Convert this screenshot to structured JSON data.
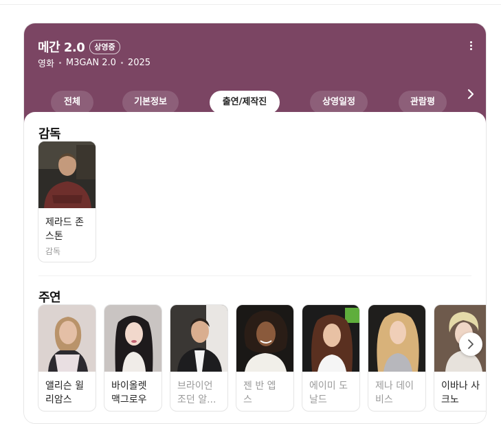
{
  "movie": {
    "title": "메간 2.0",
    "status_badge": "상영중",
    "meta": [
      "영화",
      "M3GAN 2.0",
      "2025"
    ]
  },
  "tabs": [
    "전체",
    "기본정보",
    "출연/제작진",
    "상영일정",
    "관람평"
  ],
  "active_tab": "출연/제작진",
  "directors": {
    "heading": "감독",
    "people": [
      {
        "name_lines": [
          "제라드 존",
          "스톤"
        ],
        "role": "감독"
      }
    ]
  },
  "cast": {
    "heading": "주연",
    "people": [
      {
        "name_lines": [
          "앨리슨 윌",
          "리암스"
        ]
      },
      {
        "name_lines": [
          "바이올렛",
          "맥그로우"
        ]
      },
      {
        "name_lines": [
          "브라이언",
          "조던 알..."
        ]
      },
      {
        "name_lines": [
          "젠 반 엡",
          "스"
        ]
      },
      {
        "name_lines": [
          "에이미 도",
          "날드"
        ]
      },
      {
        "name_lines": [
          "제나 데이",
          "비스"
        ]
      },
      {
        "name_lines": [
          "이바나 사",
          "크노"
        ]
      }
    ]
  },
  "icons": [
    "more-vertical-icon",
    "chevron-right-icon",
    "next-arrow-icon"
  ],
  "colors": {
    "header_bg": "#7b4563",
    "active_tab_bg": "#ffffff"
  }
}
